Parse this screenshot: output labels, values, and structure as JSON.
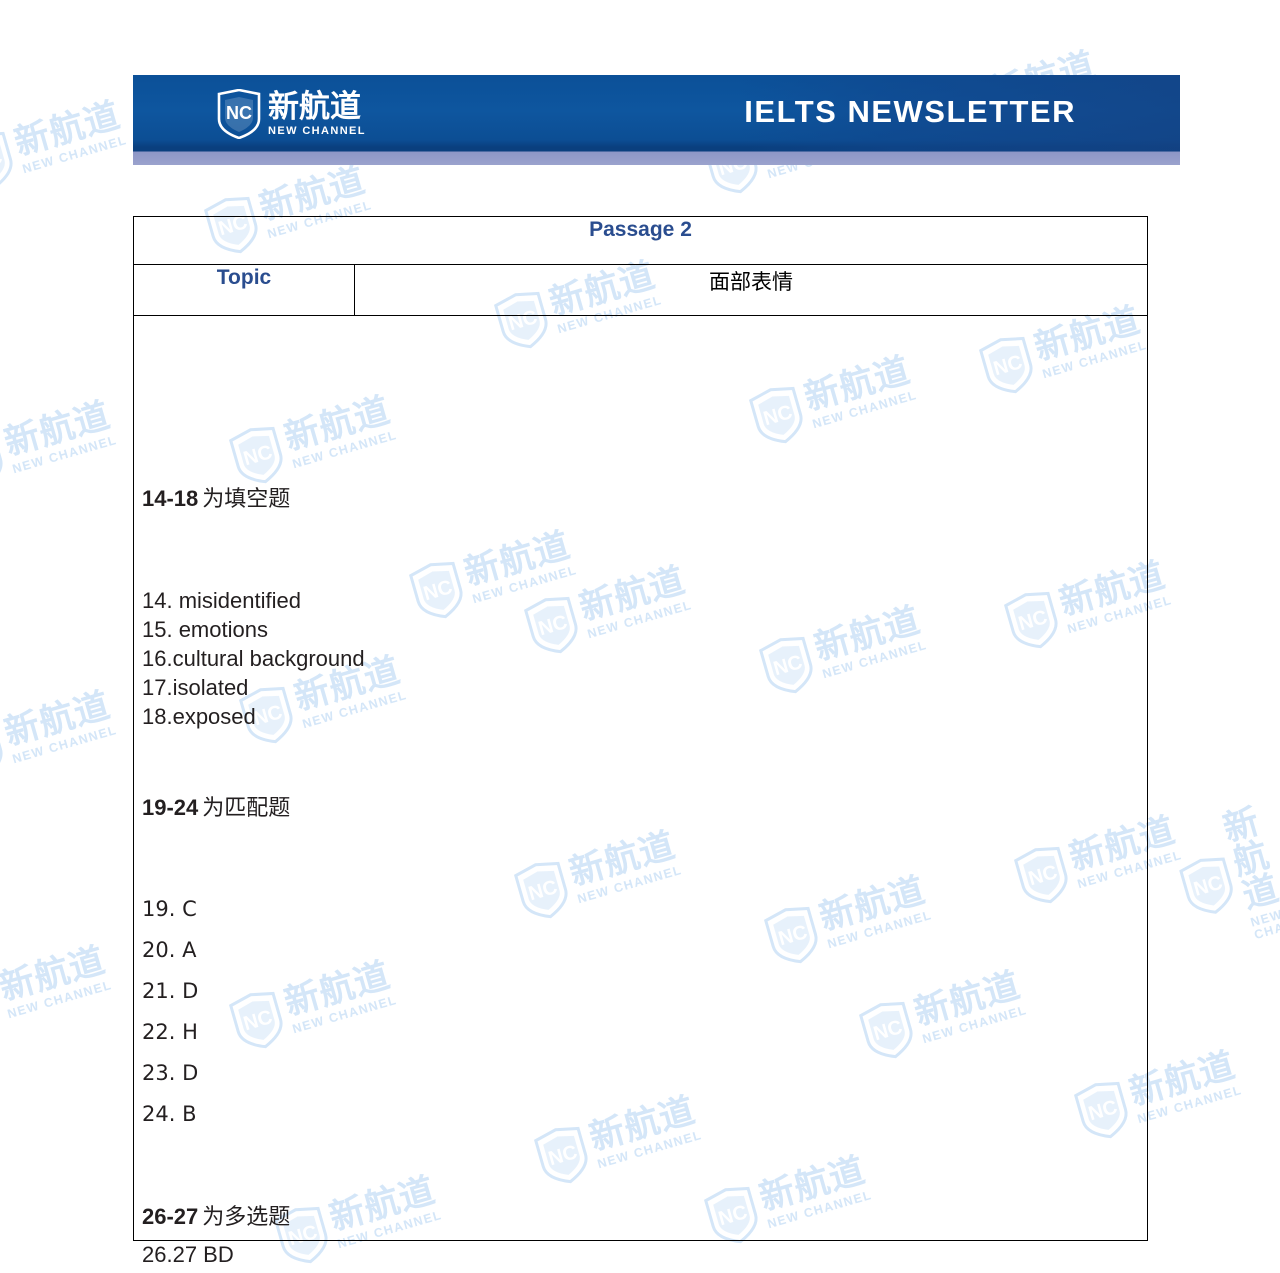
{
  "banner": {
    "title": "IELTS  NEWSLETTER",
    "logo": {
      "mark": "NC",
      "cn_name": "新航道",
      "en_name": "NEW CHANNEL"
    },
    "colors": {
      "bar_blue": "#0d5098",
      "bar_bottom_strip": "#9aa2cd"
    }
  },
  "watermark": {
    "mark": "NC",
    "cn_name": "新航道",
    "en_name": "NEW CHANNEL",
    "color": "#d4e6f8"
  },
  "table": {
    "passage_title": "Passage 2",
    "topic_label": "Topic",
    "topic_value": "面部表情",
    "accent_color": "#2a4d8f",
    "sections": [
      {
        "id": "fill-in-the-blank",
        "range": "14-18",
        "note": "为填空题",
        "answers": [
          "14. misidentified",
          "15. emotions",
          "16.cultural background",
          "17.isolated",
          "18.exposed"
        ]
      },
      {
        "id": "matching",
        "range": "19-24",
        "note": "为匹配题",
        "answers": [
          "19. C",
          "20. A",
          "21. D",
          "22. H",
          "23. D",
          "24. B"
        ]
      },
      {
        "id": "multiple-choice",
        "range": "26-27",
        "note": "为多选题",
        "answers": [
          "26.27 BD"
        ]
      }
    ]
  }
}
